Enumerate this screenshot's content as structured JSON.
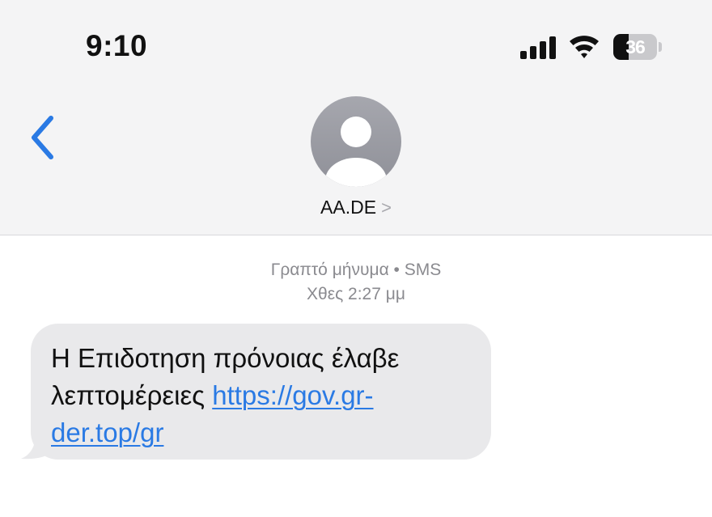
{
  "status_bar": {
    "time": "9:10",
    "battery_percent": "36",
    "battery_level": 0.36,
    "icons": [
      "cellular-signal-icon",
      "wifi-icon",
      "battery-icon"
    ]
  },
  "nav": {
    "back_icon": "chevron-left-icon",
    "contact_name": "AA.DE",
    "contact_chevron": ">",
    "avatar_icon": "person-silhouette-icon"
  },
  "conversation": {
    "message_type": "Γραπτό μήνυμα • SMS",
    "timestamp": "Χθες 2:27 μμ",
    "messages": [
      {
        "direction": "incoming",
        "text_line_1": "Η Επιδοτηση πρόνοιας έλαβε",
        "text_prefix": "λεπτομέρειες ",
        "link_part_1": "https://gov.gr-",
        "link_part_2": "der.top/gr",
        "link_url": "https://gov.gr-der.top/gr"
      }
    ]
  },
  "colors": {
    "header_bg": "#f4f4f5",
    "accent_blue": "#2a7ae4",
    "bubble_bg": "#e9e9eb",
    "meta_text": "#8a8a8f"
  }
}
